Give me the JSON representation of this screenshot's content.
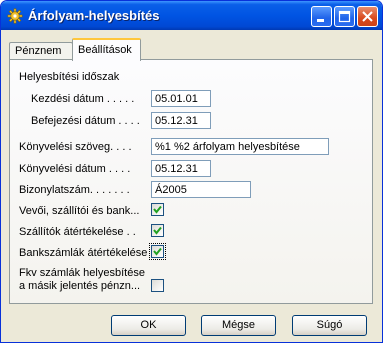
{
  "window": {
    "title": "Árfolyam-helyesbítés",
    "icon": "gear-icon"
  },
  "tabs": [
    {
      "label": "Pénznem",
      "active": false
    },
    {
      "label": "Beállítások",
      "active": true
    }
  ],
  "form": {
    "group_label": "Helyesbítési időszak",
    "start_date": {
      "label": "Kezdési dátum . . . . .",
      "value": "05.01.01"
    },
    "end_date": {
      "label": "Befejezési dátum . . . .",
      "value": "05.12.31"
    },
    "posting_desc": {
      "label": "Könyvelési szöveg. . . .",
      "value": "%1 %2 árfolyam helyesbítése"
    },
    "posting_date": {
      "label": "Könyvelési dátum . . . .",
      "value": "05.12.31"
    },
    "document_no": {
      "label": "Bizonylatszám. . . . . . .",
      "value": "Á2005"
    },
    "adjust_customers": {
      "label": "Vevői, szállítói és bank...",
      "checked": true
    },
    "adjust_vendors": {
      "label": "Szállítók átértékelése . .",
      "checked": true
    },
    "adjust_bank": {
      "label": "Bankszámlák átértékelése",
      "checked": true
    },
    "adjust_gl": {
      "label_line1": "Fkv számlák helyesbítése",
      "label_line2": "a másik jelentés pénzn...",
      "checked": false
    }
  },
  "buttons": {
    "ok": "OK",
    "cancel": "Mégse",
    "help": "Súgó"
  },
  "colors": {
    "title_bar": "#0054e3",
    "check_mark": "#21a121",
    "active_tab_highlight": "#ffc73c"
  }
}
